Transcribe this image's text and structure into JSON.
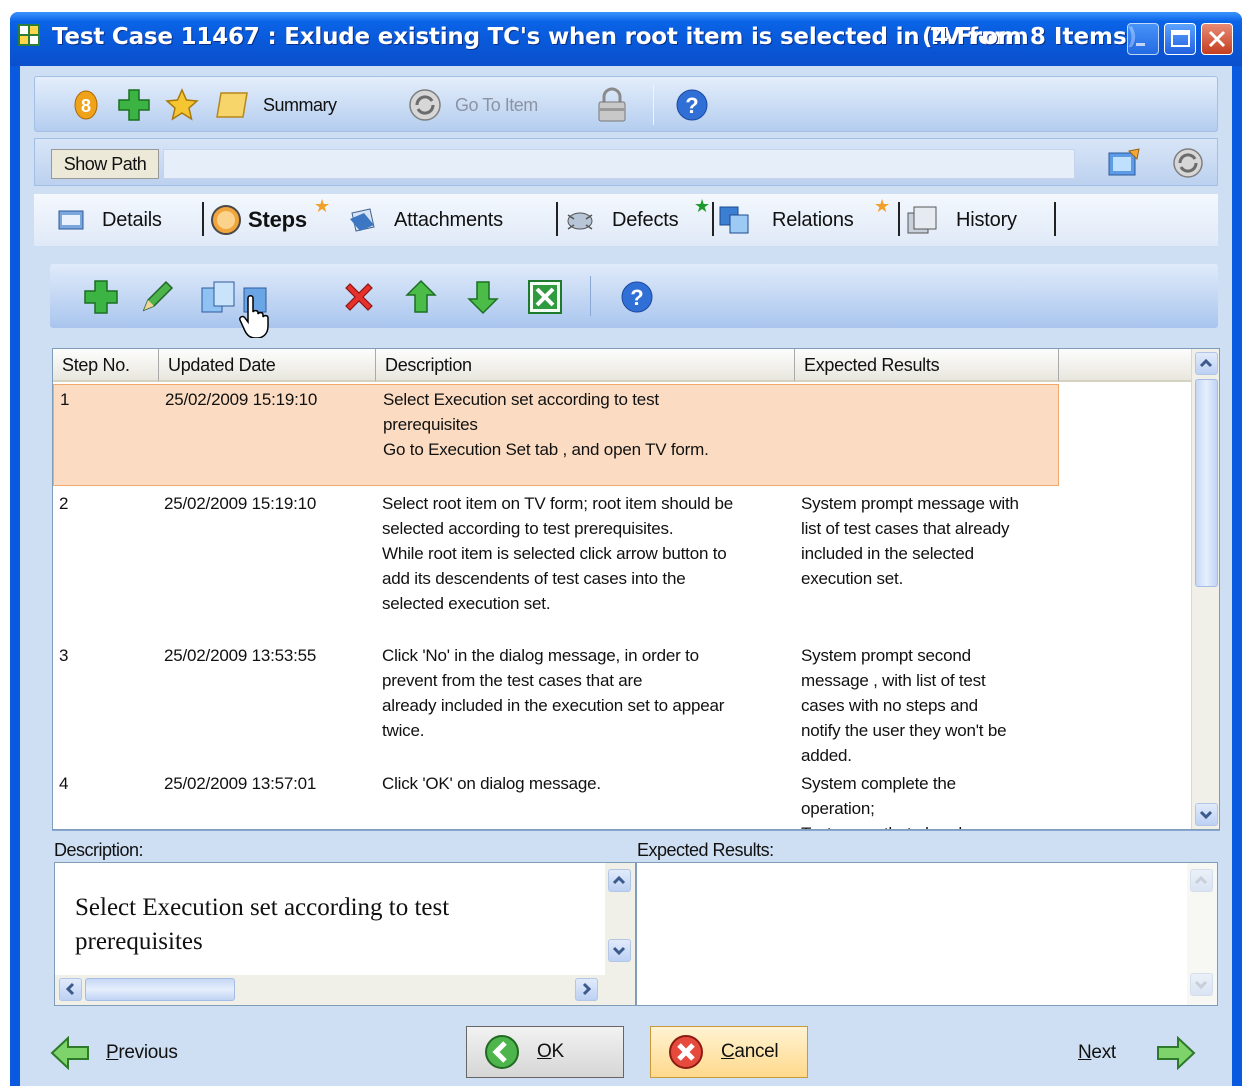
{
  "window": {
    "title": "Test Case 11467 : Exlude existing TC's when root item is selected in TV form",
    "item_count": "(4 From 8 Items)"
  },
  "toolbar": {
    "summary_label": "Summary",
    "go_to_item_label": "Go To Item"
  },
  "pathbar": {
    "show_path_label": "Show Path",
    "path_value": ""
  },
  "tabs": [
    {
      "label": "Details",
      "active": false,
      "modified": false
    },
    {
      "label": "Steps",
      "active": true,
      "modified": true
    },
    {
      "label": "Attachments",
      "active": false,
      "modified": false
    },
    {
      "label": "Defects",
      "active": false,
      "modified": true
    },
    {
      "label": "Relations",
      "active": false,
      "modified": true
    },
    {
      "label": "History",
      "active": false,
      "modified": false
    }
  ],
  "grid": {
    "columns": [
      "Step No.",
      "Updated Date",
      "Description",
      "Expected Results"
    ],
    "rows": [
      {
        "no": "1",
        "date": "25/02/2009 15:19:10",
        "description": [
          "Select Execution set according to test",
          "prerequisites",
          "Go to Execution Set tab , and open TV form."
        ],
        "expected": []
      },
      {
        "no": "2",
        "date": "25/02/2009 15:19:10",
        "description": [
          "Select root item on TV form; root item should be",
          "selected according to test prerequisites.",
          "While root item is selected click arrow button to",
          "add its descendents of test cases into the",
          "selected execution set."
        ],
        "expected": [
          "System prompt message with",
          "list of test cases that already",
          "included in the selected",
          "execution set."
        ]
      },
      {
        "no": "3",
        "date": "25/02/2009 13:53:55",
        "description": [
          "Click 'No' in the dialog message, in order to",
          "prevent from the test cases that are",
          "already included in the execution set to appear",
          "twice."
        ],
        "expected": [
          "System prompt second",
          "message , with list of test",
          "cases with no steps and",
          "notify the user they won't be",
          "added."
        ]
      },
      {
        "no": "4",
        "date": "25/02/2009 13:57:01",
        "description": [
          "Click 'OK' on dialog message."
        ],
        "expected": [
          "System complete the",
          "operation;",
          "Test cases that already"
        ]
      }
    ]
  },
  "detail": {
    "description_label": "Description:",
    "expected_label": "Expected Results:",
    "description_line1": "Select Execution set according to test",
    "description_line2": "prerequisites",
    "expected_value": ""
  },
  "footer": {
    "previous_label": "Previous",
    "previous_mnemonic": "P",
    "previous_rest": "revious",
    "ok_mnemonic": "O",
    "ok_rest": "K",
    "cancel_mnemonic": "C",
    "cancel_rest": "ancel",
    "next_mnemonic": "N",
    "next_rest": "ext"
  },
  "colors": {
    "titlebar": "#0a5adf",
    "client": "#cfdff3",
    "selected_row": "#fbdcc2",
    "tab_star": "#f1a129",
    "tab_star_green": "#1c9b2c"
  }
}
